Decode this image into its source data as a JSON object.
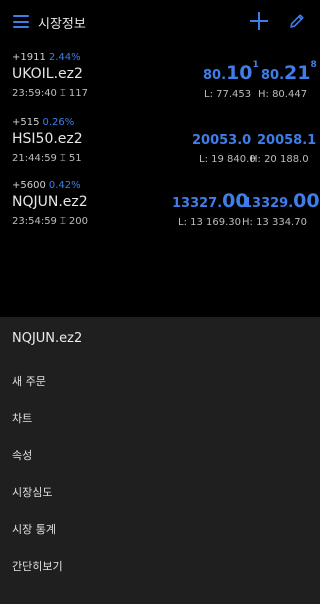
{
  "header": {
    "title": "시장정보",
    "icons": [
      "menu-icon",
      "plus-icon",
      "pencil-icon"
    ],
    "accent_color": "#3f7ee8"
  },
  "quotes": [
    {
      "change": "+1911",
      "change_pct": "2.44%",
      "symbol": "UKOIL.ez2",
      "time": "23:59:40",
      "spread": "117",
      "bid": {
        "pre": "80.",
        "big": "10",
        "sup": "1"
      },
      "ask": {
        "pre": "80.",
        "big": "21",
        "sup": "8"
      },
      "low": "L: 77.453",
      "high": "H: 80.447"
    },
    {
      "change": "+515",
      "change_pct": "0.26%",
      "symbol": "HSI50.ez2",
      "time": "21:44:59",
      "spread": "51",
      "bid_text": "20053.0",
      "ask_text": "20058.1",
      "low": "L: 19 840.0",
      "high": "H: 20 188.0"
    },
    {
      "change": "+5600",
      "change_pct": "0.42%",
      "symbol": "NQJUN.ez2",
      "time": "23:54:59",
      "spread": "200",
      "bid": {
        "pre": "13327.",
        "big": "00",
        "sup": ""
      },
      "ask": {
        "pre": "13329.",
        "big": "00",
        "sup": ""
      },
      "low": "L: 13 169.30",
      "high": "H: 13 334.70"
    }
  ],
  "sheet": {
    "title": "NQJUN.ez2",
    "items": [
      "새 주문",
      "차트",
      "속성",
      "시장심도",
      "시장 통계",
      "간단히보기"
    ]
  }
}
